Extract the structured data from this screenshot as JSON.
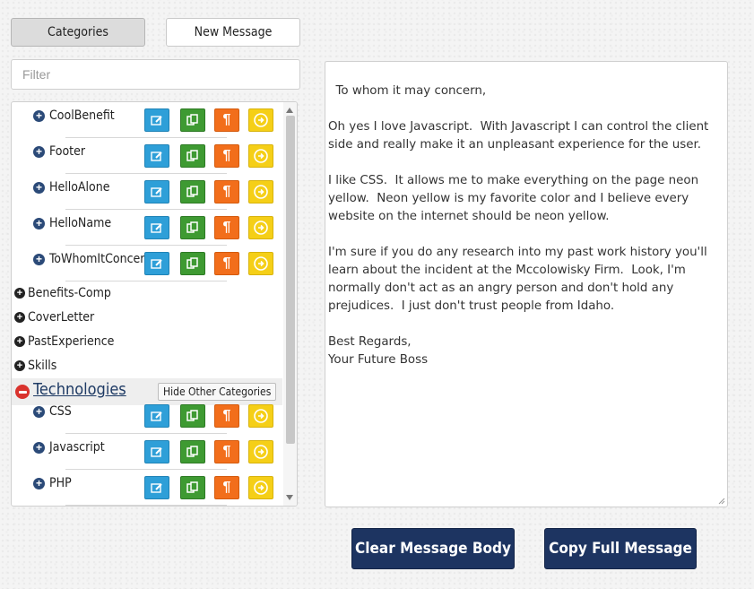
{
  "toolbar": {
    "categories_label": "Categories",
    "new_message_label": "New Message"
  },
  "filter": {
    "placeholder": "Filter",
    "value": ""
  },
  "snippets_top": [
    {
      "name": "CoolBenefit"
    },
    {
      "name": "Footer"
    },
    {
      "name": "HelloAlone"
    },
    {
      "name": "HelloName"
    },
    {
      "name": "ToWhomItConcern"
    }
  ],
  "categories": [
    {
      "name": "Benefits-Comp"
    },
    {
      "name": "CoverLetter"
    },
    {
      "name": "PastExperience"
    },
    {
      "name": "Skills"
    }
  ],
  "expanded_category": {
    "name": "Technologies",
    "tooltip": "Hide Other Categories"
  },
  "snippets_tech": [
    {
      "name": "CSS"
    },
    {
      "name": "Javascript"
    },
    {
      "name": "PHP"
    }
  ],
  "message": {
    "body": "To whom it may concern,\n\nOh yes I love Javascript.  With Javascript I can control the client side and really make it an unpleasant experience for the user.\n\nI like CSS.  It allows me to make everything on the page neon yellow.  Neon yellow is my favorite color and I believe every website on the internet should be neon yellow.\n\nI'm sure if you do any research into my past work history you'll learn about the incident at the Mccolowisky Firm.  Look, I'm normally don't act as an angry person and don't hold any prejudices.  I just don't trust people from Idaho.\n\nBest Regards,\nYour Future Boss"
  },
  "actions": {
    "clear_label": "Clear Message Body",
    "copy_label": "Copy Full Message"
  },
  "colors": {
    "edit": "#2e9fd8",
    "copy": "#3e9a32",
    "paragraph": "#f26e1b",
    "insert": "#f5cf17",
    "primary_button": "#1d3461",
    "collapse": "#d9322d"
  },
  "icons": {
    "expand": "plus-circle-icon",
    "collapse": "minus-circle-icon",
    "edit": "edit-icon",
    "copy": "copy-icon",
    "paragraph": "paragraph-icon",
    "insert": "arrow-right-circle-icon"
  }
}
